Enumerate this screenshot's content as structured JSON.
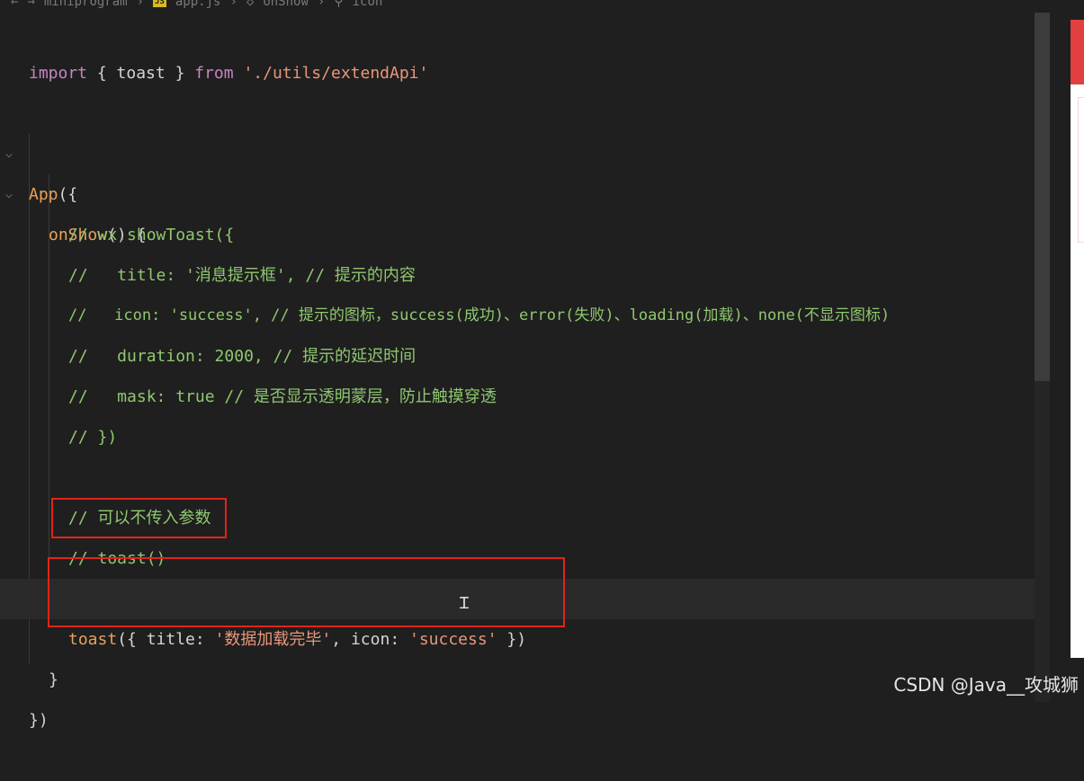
{
  "breadcrumb": {
    "folder": "miniprogram",
    "file_badge": "JS",
    "file": "app.js",
    "method": "onShow",
    "symbol": "icon"
  },
  "code": {
    "import_kw": "import",
    "import_names": " { toast } ",
    "from_kw": "from",
    "import_path": "'./utils/extendApi'",
    "app_call": "App",
    "app_open": "({",
    "onshow_name": "onShow",
    "onshow_sig": "() {",
    "c1": "// wx.showToast({",
    "c2": "//   title: '消息提示框', // 提示的内容",
    "c3": "//   icon: 'success', // 提示的图标，success(成功)、error(失败)、loading(加载)、none(不显示图标)",
    "c4": "//   duration: 2000, // 提示的延迟时间",
    "c5": "//   mask: true // 是否显示透明蒙层，防止触摸穿透",
    "c6": "// })",
    "c7": "// 可以不传入参数",
    "c8": "// toast()",
    "toast_fn": "toast",
    "toast_open": "({ ",
    "title_key": "title",
    "colon1": ": ",
    "title_val": "'数据加载完毕'",
    "comma": ", ",
    "icon_key": "icon",
    "colon2": ": ",
    "icon_val": "'success'",
    "toast_close": " })",
    "close_brace": "}",
    "close_app": "})"
  },
  "watermark": "CSDN @Java__攻城狮",
  "colors": {
    "highlight_box": "#e2231a",
    "comment": "#8fc86f",
    "string": "#e9967a",
    "function": "#e8a25a",
    "keyword": "#c586c0"
  },
  "icons": {
    "fold_open": "chevron-down-icon",
    "method": "cube-icon",
    "symbol": "wrench-icon"
  }
}
